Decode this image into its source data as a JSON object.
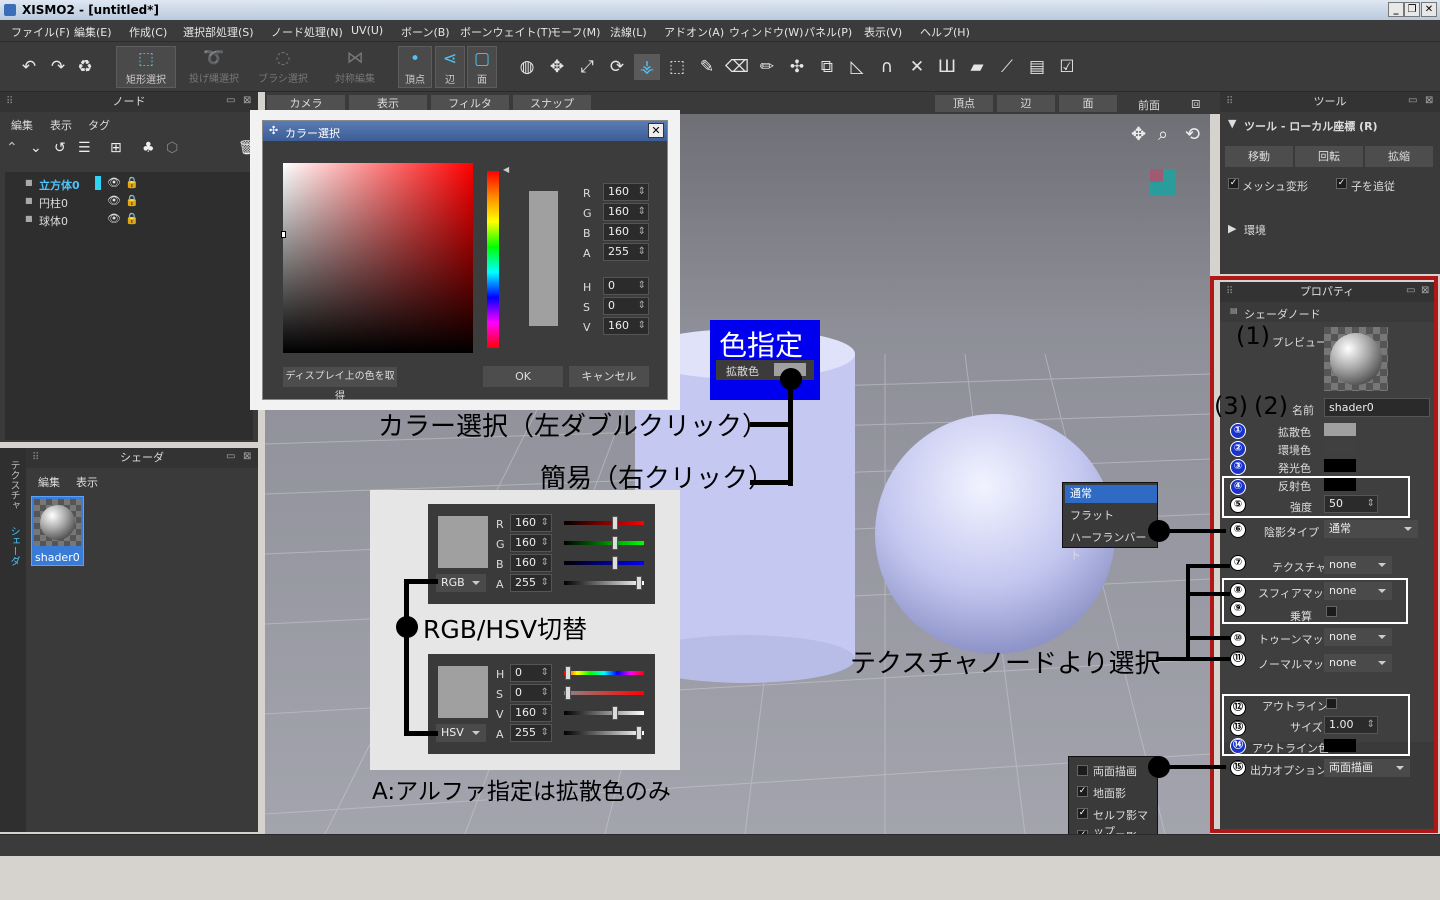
{
  "app": {
    "title": "XISMO2 - [untitled*]"
  },
  "menu": [
    "ファイル(F)",
    "編集(E)",
    "作成(C)",
    "選択部処理(S)",
    "ノード処理(N)",
    "UV(U)",
    "ボーン(B)",
    "ボーンウェイト(T)",
    "モーフ(M)",
    "法線(L)",
    "アドオン(A)",
    "ウィンドウ(W)",
    "パネル(P)",
    "表示(V)",
    "ヘルプ(H)"
  ],
  "toolbar": {
    "rect_select": "矩形選択",
    "lasso_select": "投げ縄選択",
    "brush_select": "ブラシ選択",
    "symmetry_edit": "対称編集",
    "vertex": "頂点",
    "edge": "辺",
    "face": "面"
  },
  "node_panel": {
    "title": "ノード",
    "menu_edit": "編集",
    "menu_view": "表示",
    "menu_tag": "タグ",
    "items": [
      {
        "name": "立方体0"
      },
      {
        "name": "円柱0"
      },
      {
        "name": "球体0"
      }
    ]
  },
  "shader_panel": {
    "title": "シェーダ",
    "menu_edit": "編集",
    "menu_view": "表示",
    "item": "shader0",
    "side_tab_texture": "テクスチャ",
    "side_tab_shader": "シェーダ"
  },
  "viewport": {
    "camera": "カメラ",
    "display": "表示",
    "filter": "フィルタ",
    "snap": "スナップ",
    "vertex": "頂点",
    "edge": "辺",
    "face": "面",
    "front": "前面"
  },
  "color_dialog": {
    "title": "カラー選択",
    "labels": {
      "r": "R",
      "g": "G",
      "b": "B",
      "a": "A",
      "h": "H",
      "s": "S",
      "v": "V"
    },
    "r": "160",
    "g": "160",
    "b": "160",
    "a": "255",
    "h": "0",
    "s": "0",
    "v": "160",
    "pick_button": "ディスプレイ上の色を取得",
    "ok": "OK",
    "cancel": "キャンセル"
  },
  "tool_panel": {
    "title": "ツール",
    "section": "ツール - ローカル座標 (R)",
    "move": "移動",
    "rotate": "回転",
    "scale": "拡縮",
    "mesh_transform": "メッシュ変形",
    "follow_child": "子を追従",
    "environment": "環境"
  },
  "properties": {
    "title": "プロパティ",
    "section": "シェーダノード",
    "preview": "プレビュー",
    "name_label": "名前",
    "name_value": "shader0",
    "diffuse": "拡散色",
    "ambient": "環境色",
    "emissive": "発光色",
    "specular": "反射色",
    "strength": "強度",
    "strength_value": "50",
    "shade_type": "陰影タイプ",
    "shade_type_value": "通常",
    "texture": "テクスチャ",
    "sphere_map": "スフィアマップ",
    "multiply": "乗算",
    "toon_map": "トゥーンマップ",
    "normal_map": "ノーマルマップ",
    "none": "none",
    "outline": "アウトライン",
    "size": "サイズ",
    "size_value": "1.00",
    "outline_color": "アウトライン色",
    "output_option": "出力オプション",
    "output_value": "両面描画"
  },
  "shade_menu": [
    "通常",
    "フラット",
    "ハーフランバート"
  ],
  "output_menu": [
    "両面描画",
    "地面影",
    "セルフ影マップ",
    "セルフ影"
  ],
  "annotations": {
    "color_spec": "色指定",
    "diffuse_small": "拡散色",
    "color_select": "カラー選択（左ダブルクリック）",
    "simple": "簡易（右クリック）",
    "rgb_hsv": "RGB/HSV切替",
    "alpha_note": "A:アルファ指定は拡散色のみ",
    "texture_node": "テクスチャノードより選択",
    "p1": "(1)",
    "p2": "(2)",
    "p3": "(3)"
  },
  "mini_rgb": {
    "mode": "RGB",
    "labels": [
      "R",
      "G",
      "B",
      "A"
    ],
    "values": [
      "160",
      "160",
      "160",
      "255"
    ]
  },
  "mini_hsv": {
    "mode": "HSV",
    "labels": [
      "H",
      "S",
      "V",
      "A"
    ],
    "values": [
      "0",
      "0",
      "160",
      "255"
    ]
  },
  "circled": [
    "①",
    "②",
    "③",
    "④",
    "⑤",
    "⑥",
    "⑦",
    "⑧",
    "⑨",
    "⑩",
    "⑪",
    "⑫",
    "⑬",
    "⑭",
    "⑮"
  ],
  "colors": {
    "highlight_red": "#b01818",
    "accent_blue": "#0000ee",
    "selected_cyan": "#4fc3f7"
  }
}
